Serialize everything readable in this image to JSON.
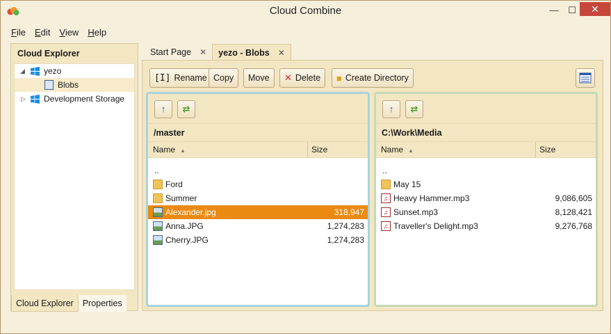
{
  "window": {
    "title": "Cloud Combine",
    "minimize": "—",
    "maximize": "☐",
    "close": "✕"
  },
  "menu": [
    {
      "label": "File",
      "mnemonic": "F",
      "rest": "ile"
    },
    {
      "label": "Edit",
      "mnemonic": "E",
      "rest": "dit"
    },
    {
      "label": "View",
      "mnemonic": "V",
      "rest": "iew"
    },
    {
      "label": "Help",
      "mnemonic": "H",
      "rest": "elp"
    }
  ],
  "explorer": {
    "header": "Cloud Explorer",
    "tree": [
      {
        "label": "yezo",
        "expanded": true
      },
      {
        "label": "Blobs",
        "selected": true
      },
      {
        "label": "Development Storage",
        "expanded": false
      }
    ],
    "bottom_tabs": [
      "Cloud Explorer",
      "Properties"
    ]
  },
  "doc_tabs": [
    {
      "label": "Start Page",
      "active": false
    },
    {
      "label": "yezo - Blobs",
      "active": true
    }
  ],
  "toolbar": {
    "rename": "Rename",
    "copy": "Copy",
    "move": "Move",
    "delete": "Delete",
    "create_directory": "Create Directory"
  },
  "left_panel": {
    "path": "/master",
    "col_name": "Name",
    "col_size": "Size",
    "files": [
      {
        "name": "..",
        "size": "",
        "type": "up"
      },
      {
        "name": "Ford",
        "size": "",
        "type": "folder"
      },
      {
        "name": "Summer",
        "size": "",
        "type": "folder"
      },
      {
        "name": "Alexander.jpg",
        "size": "318,947",
        "type": "image",
        "selected": true
      },
      {
        "name": "Anna.JPG",
        "size": "1,274,283",
        "type": "image"
      },
      {
        "name": "Cherry.JPG",
        "size": "1,274,283",
        "type": "image"
      }
    ]
  },
  "right_panel": {
    "path": "C:\\Work\\Media",
    "col_name": "Name",
    "col_size": "Size",
    "files": [
      {
        "name": "..",
        "size": "",
        "type": "up"
      },
      {
        "name": "May 15",
        "size": "",
        "type": "folder"
      },
      {
        "name": "Heavy Hammer.mp3",
        "size": "9,086,605",
        "type": "mp3"
      },
      {
        "name": "Sunset.mp3",
        "size": "8,128,421",
        "type": "mp3"
      },
      {
        "name": "Traveller's Delight.mp3",
        "size": "9,276,768",
        "type": "mp3"
      }
    ]
  },
  "colors": {
    "accent_selected": "#ea8a12",
    "left_panel_border": "#a6d4e0",
    "right_panel_border": "#c4d9b4",
    "close_button": "#c7463b"
  }
}
